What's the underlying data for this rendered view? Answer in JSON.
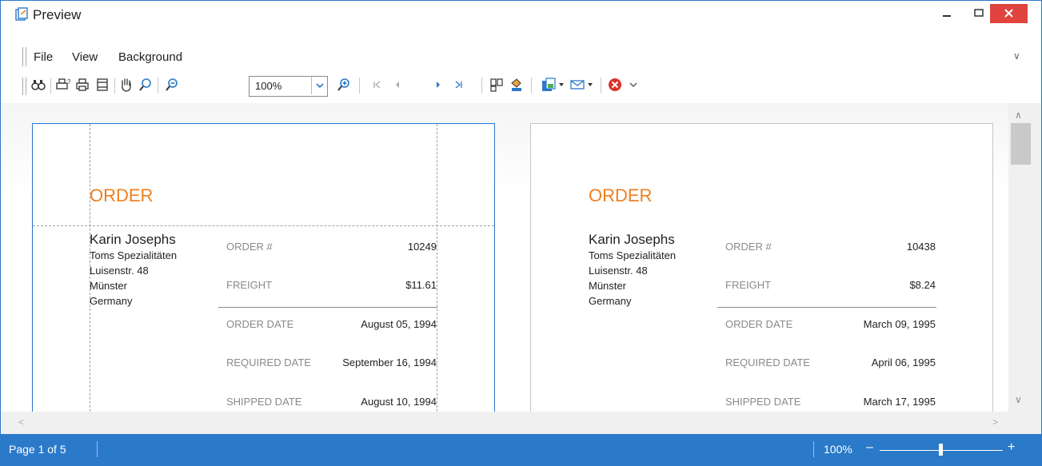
{
  "window": {
    "title": "Preview"
  },
  "menu": {
    "items": [
      "File",
      "View",
      "Background"
    ]
  },
  "toolbar": {
    "zoom_value": "100%",
    "icons": [
      "find-icon",
      "print-setup-icon",
      "print-icon",
      "page-setup-icon",
      "hand-tool-icon",
      "magnifier-icon",
      "zoom-out-icon",
      "zoom-in-icon",
      "first-page-icon",
      "previous-page-icon",
      "next-page-icon",
      "last-page-icon",
      "multiple-pages-icon",
      "background-color-icon",
      "export-icon",
      "send-email-icon",
      "close-preview-icon"
    ]
  },
  "pages": [
    {
      "title": "ORDER",
      "customer": {
        "name": "Karin Josephs",
        "company": "Toms Spezialitäten",
        "street": "Luisenstr. 48",
        "city": "Münster",
        "country": "Germany"
      },
      "fields": [
        {
          "label": "ORDER #",
          "value": "10249"
        },
        {
          "label": "FREIGHT",
          "value": "$11.61"
        },
        {
          "label": "ORDER DATE",
          "value": "August 05, 1994"
        },
        {
          "label": "REQUIRED DATE",
          "value": "September 16, 1994"
        },
        {
          "label": "SHIPPED DATE",
          "value": "August 10, 1994"
        }
      ]
    },
    {
      "title": "ORDER",
      "customer": {
        "name": "Karin Josephs",
        "company": "Toms Spezialitäten",
        "street": "Luisenstr. 48",
        "city": "Münster",
        "country": "Germany"
      },
      "fields": [
        {
          "label": "ORDER #",
          "value": "10438"
        },
        {
          "label": "FREIGHT",
          "value": "$8.24"
        },
        {
          "label": "ORDER DATE",
          "value": "March 09, 1995"
        },
        {
          "label": "REQUIRED DATE",
          "value": "April 06, 1995"
        },
        {
          "label": "SHIPPED DATE",
          "value": "March 17, 1995"
        }
      ]
    }
  ],
  "status": {
    "page_info": "Page 1 of 5",
    "zoom": "100%",
    "zoom_level_percent": 100
  },
  "colors": {
    "accent": "#2b79c9",
    "order_title": "#f07e1e",
    "close_button": "#e0443f"
  }
}
